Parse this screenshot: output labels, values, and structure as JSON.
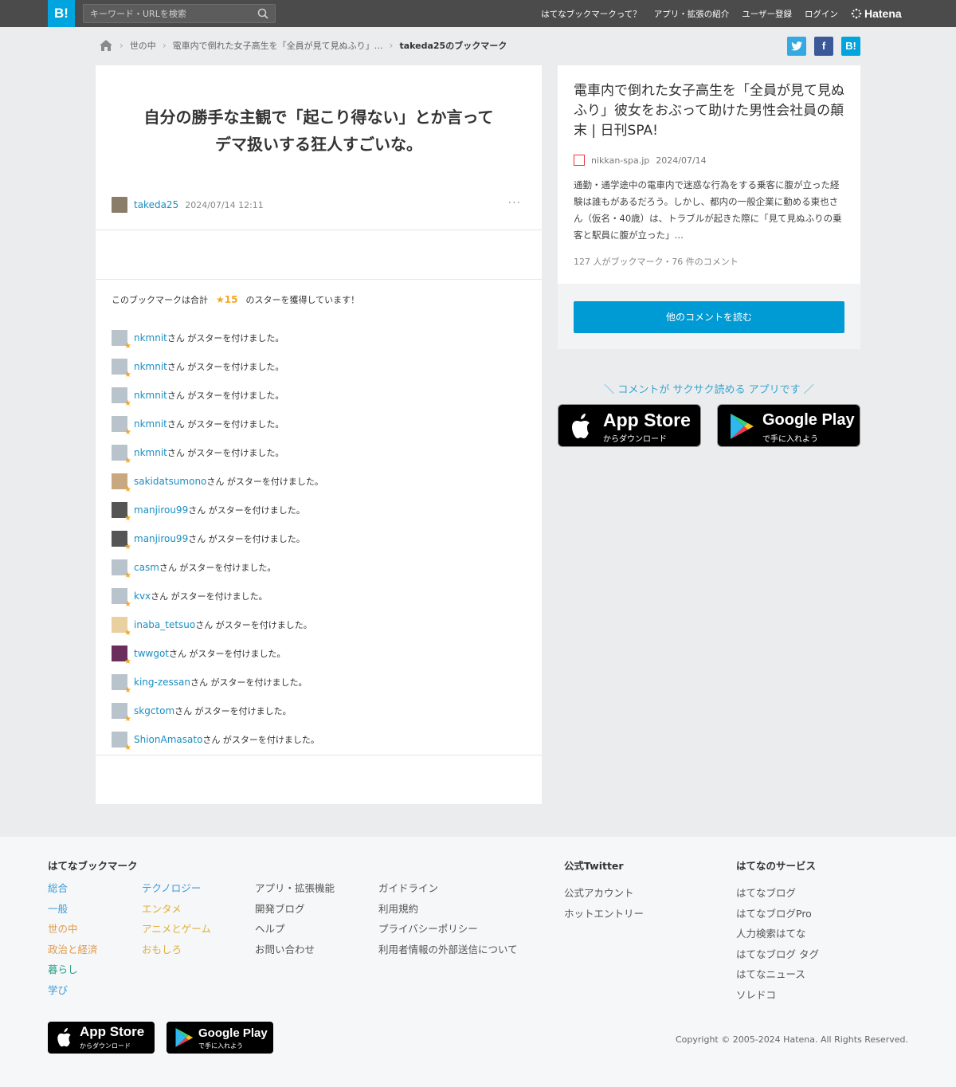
{
  "topbar": {
    "logo": "B!",
    "search_placeholder": "キーワード・URLを検索",
    "nav": [
      "はてなブックマークって？",
      "アプリ・拡張の紹介",
      "ユーザー登録",
      "ログイン"
    ],
    "brand": "Hatena"
  },
  "breadcrumb": {
    "items": [
      "世の中",
      "電車内で倒れた女子高生を「全員が見て見ぬふり」…",
      "takeda25のブックマーク"
    ]
  },
  "share": {
    "twitter": "t",
    "facebook": "f",
    "hatena": "B!"
  },
  "bookmark": {
    "comment_line1": "自分の勝手な主観で「起こり得ない」とか言って",
    "comment_line2": "デマ扱いする狂人すごいな。",
    "user": "takeda25",
    "datetime": "2024/07/14 12:11",
    "more": "···"
  },
  "stars": {
    "summary_prefix": "このブックマークは合計",
    "count": "★15",
    "summary_suffix": "のスターを獲得しています！",
    "suffix_text": "さん がスターを付けました。",
    "users": [
      "nkmnit",
      "nkmnit",
      "nkmnit",
      "nkmnit",
      "nkmnit",
      "sakidatsumono",
      "manjirou99",
      "manjirou99",
      "casm",
      "kvx",
      "inaba_tetsuo",
      "twwgot",
      "king-zessan",
      "skgctom",
      "ShionAmasato"
    ]
  },
  "entry": {
    "title": "電車内で倒れた女子高生を「全員が見て見ぬふり」彼女をおぶって助けた男性会社員の顛末 | 日刊SPA!",
    "domain": "nikkan-spa.jp",
    "date": "2024/07/14",
    "description": "通勤・通学途中の電車内で迷惑な行為をする乗客に腹が立った経験は誰もがあるだろう。しかし、都内の一般企業に勤める東也さん（仮名・40歳）は、トラブルが起きた際に「見て見ぬふりの乗客と駅員に腹が立った」…",
    "counts": "127 人がブックマーク・76 件のコメント",
    "read_button": "他のコメントを読む"
  },
  "promo": {
    "text": "＼ コメントが サクサク読める アプリです ／",
    "app_store_big": "App Store",
    "app_store_small": "からダウンロード",
    "google_play_big": "Google Play",
    "google_play_small": "で手に入れよう"
  },
  "footer": {
    "col1_title": "はてなブックマーク",
    "col1a": [
      "総合",
      "一般",
      "世の中",
      "政治と経済",
      "暮らし",
      "学び"
    ],
    "col1b": [
      "テクノロジー",
      "エンタメ",
      "アニメとゲーム",
      "おもしろ"
    ],
    "col1c": [
      "アプリ・拡張機能",
      "開発ブログ",
      "ヘルプ",
      "お問い合わせ"
    ],
    "col1d": [
      "ガイドライン",
      "利用規約",
      "プライバシーポリシー",
      "利用者情報の外部送信について"
    ],
    "col2_title": "公式Twitter",
    "col2": [
      "公式アカウント",
      "ホットエントリー"
    ],
    "col3_title": "はてなのサービス",
    "col3": [
      "はてなブログ",
      "はてなブログPro",
      "人力検索はてな",
      "はてなブログ タグ",
      "はてなニュース",
      "ソレドコ"
    ],
    "copyright": "Copyright © 2005-2024 Hatena. All Rights Reserved."
  },
  "colors": {
    "accent": "#00a4de",
    "link": "#1a8ec2",
    "star": "#f5a623",
    "cat_general": "#3a9ad9",
    "cat_general2": "#3a9ad9",
    "cat_social": "#e09a4a",
    "cat_economics": "#e09a4a",
    "cat_life": "#2aa38a",
    "cat_knowledge": "#3a9ad9",
    "cat_it": "#3a9ad9",
    "cat_entertainment": "#e0b03a",
    "cat_game": "#e0b03a",
    "cat_fun": "#e0b03a"
  }
}
